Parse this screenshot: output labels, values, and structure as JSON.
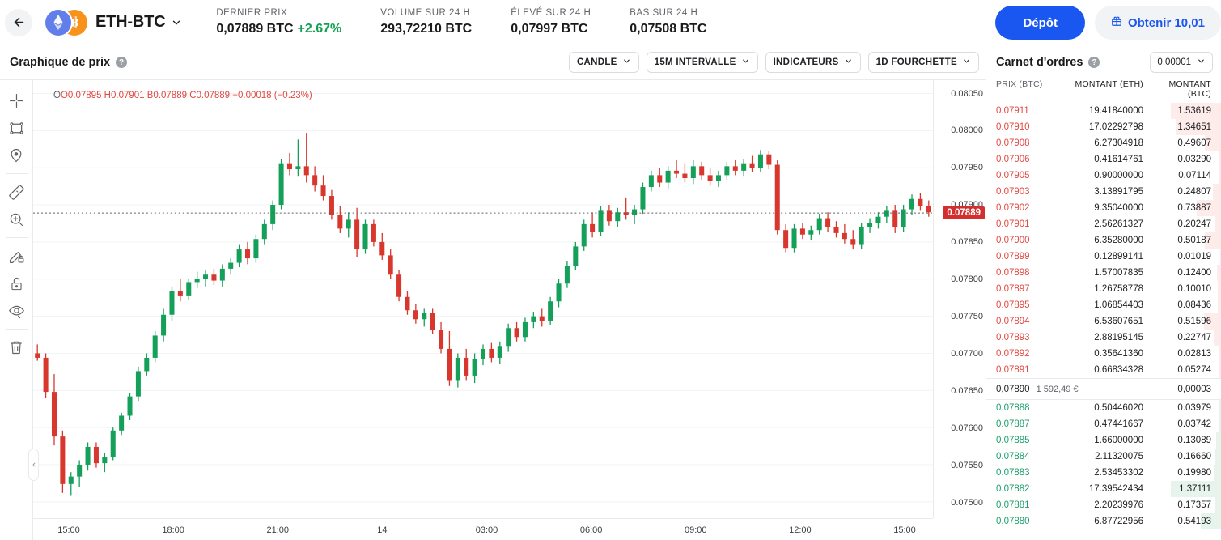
{
  "header": {
    "back_icon": "arrow-left-icon",
    "pair": {
      "name": "ETH-BTC",
      "base_icon": "ethereum-icon",
      "quote_icon": "bitcoin-icon",
      "caret_icon": "chevron-down-icon"
    },
    "stats": [
      {
        "label": "DERNIER PRIX",
        "value": "0,07889 BTC",
        "change": "+2.67%"
      },
      {
        "label": "VOLUME SUR 24 H",
        "value": "293,72210 BTC",
        "change": ""
      },
      {
        "label": "ÉLEVÉ SUR 24 H",
        "value": "0,07997 BTC",
        "change": ""
      },
      {
        "label": "BAS SUR 24 H",
        "value": "0,07508 BTC",
        "change": ""
      }
    ],
    "deposit_button": "Dépôt",
    "obtenir_button": "Obtenir 10,01",
    "obtenir_icon": "gift-icon"
  },
  "chart": {
    "title": "Graphique de prix",
    "help_icon": "help-circle-icon",
    "controls": [
      {
        "label": "CANDLE",
        "icon": "chevron-down-icon"
      },
      {
        "label": "15M INTERVALLE",
        "icon": "chevron-down-icon"
      },
      {
        "label": "INDICATEURS",
        "icon": "chevron-down-icon"
      },
      {
        "label": "1D FOURCHETTE",
        "icon": "chevron-down-icon"
      }
    ],
    "ohlc": {
      "o": "O0.07895",
      "h": "H0.07901",
      "b": "B0.07889",
      "c": "C0.07889",
      "chg": "−0.00018 (−0.23%)"
    },
    "tools": [
      "crosshair-icon",
      "shape-rectangle-icon",
      "location-pin-icon",
      "ruler-icon",
      "zoom-in-icon",
      "pencil-lock-icon",
      "lock-icon",
      "eye-icon",
      "trash-icon"
    ],
    "collapse_icon": "chevron-left-icon",
    "current_price_marker": "0.07889",
    "colors": {
      "up": "#15a05a",
      "down": "#d8372e",
      "marker": "#d32f2f"
    }
  },
  "chart_data": {
    "type": "line",
    "title": "Graphique de prix",
    "xlabel": "",
    "ylabel": "",
    "ylim": [
      0.07478,
      0.08068
    ],
    "y_ticks": [
      "0.08050",
      "0.08000",
      "0.07950",
      "0.07900",
      "0.07850",
      "0.07800",
      "0.07750",
      "0.07700",
      "0.07650",
      "0.07600",
      "0.07550",
      "0.07500"
    ],
    "x_ticks": [
      "15:00",
      "18:00",
      "21:00",
      "14",
      "03:00",
      "06:00",
      "09:00",
      "12:00",
      "15:00"
    ],
    "grid": true,
    "legend": "none",
    "current_price": 0.07889,
    "ohlc": [
      {
        "o": 0.077,
        "h": 0.07712,
        "l": 0.0769,
        "c": 0.07694
      },
      {
        "o": 0.07694,
        "h": 0.077,
        "l": 0.0764,
        "c": 0.07648
      },
      {
        "o": 0.07648,
        "h": 0.07672,
        "l": 0.07576,
        "c": 0.07588
      },
      {
        "o": 0.07588,
        "h": 0.07596,
        "l": 0.07512,
        "c": 0.07524
      },
      {
        "o": 0.07524,
        "h": 0.0754,
        "l": 0.07508,
        "c": 0.07534
      },
      {
        "o": 0.07534,
        "h": 0.07556,
        "l": 0.0752,
        "c": 0.0755
      },
      {
        "o": 0.0755,
        "h": 0.0758,
        "l": 0.07542,
        "c": 0.07574
      },
      {
        "o": 0.07574,
        "h": 0.0758,
        "l": 0.07546,
        "c": 0.07552
      },
      {
        "o": 0.07552,
        "h": 0.07566,
        "l": 0.0754,
        "c": 0.0756
      },
      {
        "o": 0.0756,
        "h": 0.076,
        "l": 0.07556,
        "c": 0.07596
      },
      {
        "o": 0.07596,
        "h": 0.0762,
        "l": 0.0759,
        "c": 0.07616
      },
      {
        "o": 0.07616,
        "h": 0.07646,
        "l": 0.0761,
        "c": 0.07642
      },
      {
        "o": 0.07642,
        "h": 0.07682,
        "l": 0.07636,
        "c": 0.07676
      },
      {
        "o": 0.07676,
        "h": 0.077,
        "l": 0.0767,
        "c": 0.07694
      },
      {
        "o": 0.07694,
        "h": 0.0773,
        "l": 0.07688,
        "c": 0.07724
      },
      {
        "o": 0.07724,
        "h": 0.0776,
        "l": 0.07716,
        "c": 0.07752
      },
      {
        "o": 0.07752,
        "h": 0.0779,
        "l": 0.07744,
        "c": 0.07784
      },
      {
        "o": 0.07784,
        "h": 0.078,
        "l": 0.0777,
        "c": 0.07778
      },
      {
        "o": 0.07778,
        "h": 0.078,
        "l": 0.07772,
        "c": 0.07796
      },
      {
        "o": 0.07796,
        "h": 0.0781,
        "l": 0.07788,
        "c": 0.078
      },
      {
        "o": 0.078,
        "h": 0.07812,
        "l": 0.0779,
        "c": 0.07806
      },
      {
        "o": 0.07806,
        "h": 0.07814,
        "l": 0.07792,
        "c": 0.07798
      },
      {
        "o": 0.07798,
        "h": 0.0782,
        "l": 0.0779,
        "c": 0.07814
      },
      {
        "o": 0.07814,
        "h": 0.07828,
        "l": 0.07806,
        "c": 0.07822
      },
      {
        "o": 0.07822,
        "h": 0.07846,
        "l": 0.07816,
        "c": 0.0784
      },
      {
        "o": 0.0784,
        "h": 0.0785,
        "l": 0.0782,
        "c": 0.07828
      },
      {
        "o": 0.07828,
        "h": 0.0786,
        "l": 0.07822,
        "c": 0.07854
      },
      {
        "o": 0.07854,
        "h": 0.0788,
        "l": 0.07846,
        "c": 0.07874
      },
      {
        "o": 0.07874,
        "h": 0.07906,
        "l": 0.07866,
        "c": 0.079
      },
      {
        "o": 0.079,
        "h": 0.07962,
        "l": 0.07894,
        "c": 0.07956
      },
      {
        "o": 0.07956,
        "h": 0.0797,
        "l": 0.0794,
        "c": 0.07948
      },
      {
        "o": 0.07948,
        "h": 0.07988,
        "l": 0.07938,
        "c": 0.07952
      },
      {
        "o": 0.07952,
        "h": 0.07997,
        "l": 0.0793,
        "c": 0.0794
      },
      {
        "o": 0.0794,
        "h": 0.07952,
        "l": 0.07918,
        "c": 0.07926
      },
      {
        "o": 0.07926,
        "h": 0.0794,
        "l": 0.07906,
        "c": 0.07912
      },
      {
        "o": 0.07912,
        "h": 0.0792,
        "l": 0.0788,
        "c": 0.07886
      },
      {
        "o": 0.07886,
        "h": 0.07898,
        "l": 0.07862,
        "c": 0.07868
      },
      {
        "o": 0.07868,
        "h": 0.0789,
        "l": 0.07856,
        "c": 0.0788
      },
      {
        "o": 0.0788,
        "h": 0.07896,
        "l": 0.0783,
        "c": 0.0784
      },
      {
        "o": 0.0784,
        "h": 0.0788,
        "l": 0.07834,
        "c": 0.07874
      },
      {
        "o": 0.07874,
        "h": 0.0788,
        "l": 0.07844,
        "c": 0.0785
      },
      {
        "o": 0.0785,
        "h": 0.07862,
        "l": 0.07826,
        "c": 0.07832
      },
      {
        "o": 0.07832,
        "h": 0.0784,
        "l": 0.078,
        "c": 0.07806
      },
      {
        "o": 0.07806,
        "h": 0.07812,
        "l": 0.0777,
        "c": 0.07776
      },
      {
        "o": 0.07776,
        "h": 0.07784,
        "l": 0.07752,
        "c": 0.07758
      },
      {
        "o": 0.07758,
        "h": 0.07766,
        "l": 0.0774,
        "c": 0.07746
      },
      {
        "o": 0.07746,
        "h": 0.0776,
        "l": 0.07736,
        "c": 0.07754
      },
      {
        "o": 0.07754,
        "h": 0.0776,
        "l": 0.07726,
        "c": 0.07732
      },
      {
        "o": 0.07732,
        "h": 0.07742,
        "l": 0.077,
        "c": 0.07706
      },
      {
        "o": 0.07706,
        "h": 0.0773,
        "l": 0.07656,
        "c": 0.07664
      },
      {
        "o": 0.07664,
        "h": 0.077,
        "l": 0.07654,
        "c": 0.07694
      },
      {
        "o": 0.07694,
        "h": 0.07706,
        "l": 0.07664,
        "c": 0.0767
      },
      {
        "o": 0.0767,
        "h": 0.077,
        "l": 0.0766,
        "c": 0.07692
      },
      {
        "o": 0.07692,
        "h": 0.07712,
        "l": 0.07684,
        "c": 0.07706
      },
      {
        "o": 0.07706,
        "h": 0.07714,
        "l": 0.07688,
        "c": 0.07694
      },
      {
        "o": 0.07694,
        "h": 0.07716,
        "l": 0.07686,
        "c": 0.0771
      },
      {
        "o": 0.0771,
        "h": 0.0774,
        "l": 0.07702,
        "c": 0.07734
      },
      {
        "o": 0.07734,
        "h": 0.07742,
        "l": 0.07716,
        "c": 0.07722
      },
      {
        "o": 0.07722,
        "h": 0.07748,
        "l": 0.07716,
        "c": 0.07742
      },
      {
        "o": 0.07742,
        "h": 0.07756,
        "l": 0.07734,
        "c": 0.0775
      },
      {
        "o": 0.0775,
        "h": 0.0776,
        "l": 0.07736,
        "c": 0.07744
      },
      {
        "o": 0.07744,
        "h": 0.07776,
        "l": 0.07738,
        "c": 0.0777
      },
      {
        "o": 0.0777,
        "h": 0.078,
        "l": 0.07762,
        "c": 0.07794
      },
      {
        "o": 0.07794,
        "h": 0.07824,
        "l": 0.07788,
        "c": 0.07818
      },
      {
        "o": 0.07818,
        "h": 0.0785,
        "l": 0.07812,
        "c": 0.07844
      },
      {
        "o": 0.07844,
        "h": 0.0788,
        "l": 0.07838,
        "c": 0.07874
      },
      {
        "o": 0.07874,
        "h": 0.0789,
        "l": 0.07856,
        "c": 0.07864
      },
      {
        "o": 0.07864,
        "h": 0.07898,
        "l": 0.07858,
        "c": 0.07892
      },
      {
        "o": 0.07892,
        "h": 0.079,
        "l": 0.07872,
        "c": 0.07878
      },
      {
        "o": 0.07878,
        "h": 0.07896,
        "l": 0.0787,
        "c": 0.0789
      },
      {
        "o": 0.0789,
        "h": 0.0791,
        "l": 0.0788,
        "c": 0.07886
      },
      {
        "o": 0.07886,
        "h": 0.079,
        "l": 0.07874,
        "c": 0.07894
      },
      {
        "o": 0.07894,
        "h": 0.0793,
        "l": 0.07888,
        "c": 0.07924
      },
      {
        "o": 0.07924,
        "h": 0.07946,
        "l": 0.07918,
        "c": 0.0794
      },
      {
        "o": 0.0794,
        "h": 0.0795,
        "l": 0.07924,
        "c": 0.0793
      },
      {
        "o": 0.0793,
        "h": 0.07952,
        "l": 0.07922,
        "c": 0.07946
      },
      {
        "o": 0.07946,
        "h": 0.0796,
        "l": 0.07936,
        "c": 0.07942
      },
      {
        "o": 0.07942,
        "h": 0.07956,
        "l": 0.0793,
        "c": 0.07936
      },
      {
        "o": 0.07936,
        "h": 0.0796,
        "l": 0.07928,
        "c": 0.07952
      },
      {
        "o": 0.07952,
        "h": 0.07958,
        "l": 0.07934,
        "c": 0.0794
      },
      {
        "o": 0.0794,
        "h": 0.0795,
        "l": 0.07926,
        "c": 0.07932
      },
      {
        "o": 0.07932,
        "h": 0.07946,
        "l": 0.07924,
        "c": 0.0794
      },
      {
        "o": 0.0794,
        "h": 0.07958,
        "l": 0.07934,
        "c": 0.07952
      },
      {
        "o": 0.07952,
        "h": 0.0796,
        "l": 0.0794,
        "c": 0.07946
      },
      {
        "o": 0.07946,
        "h": 0.07962,
        "l": 0.07938,
        "c": 0.07956
      },
      {
        "o": 0.07956,
        "h": 0.07966,
        "l": 0.07944,
        "c": 0.0795
      },
      {
        "o": 0.0795,
        "h": 0.07974,
        "l": 0.07944,
        "c": 0.07968
      },
      {
        "o": 0.07968,
        "h": 0.07972,
        "l": 0.07948,
        "c": 0.07954
      },
      {
        "o": 0.07954,
        "h": 0.0796,
        "l": 0.0786,
        "c": 0.07866
      },
      {
        "o": 0.07866,
        "h": 0.07874,
        "l": 0.07836,
        "c": 0.07842
      },
      {
        "o": 0.07842,
        "h": 0.07874,
        "l": 0.07836,
        "c": 0.07868
      },
      {
        "o": 0.07868,
        "h": 0.07876,
        "l": 0.07854,
        "c": 0.0786
      },
      {
        "o": 0.0786,
        "h": 0.07872,
        "l": 0.07852,
        "c": 0.07866
      },
      {
        "o": 0.07866,
        "h": 0.07888,
        "l": 0.0786,
        "c": 0.07882
      },
      {
        "o": 0.07882,
        "h": 0.0789,
        "l": 0.07864,
        "c": 0.0787
      },
      {
        "o": 0.0787,
        "h": 0.07878,
        "l": 0.07856,
        "c": 0.07862
      },
      {
        "o": 0.07862,
        "h": 0.07874,
        "l": 0.07848,
        "c": 0.07854
      },
      {
        "o": 0.07854,
        "h": 0.07866,
        "l": 0.0784,
        "c": 0.07846
      },
      {
        "o": 0.07846,
        "h": 0.07876,
        "l": 0.0784,
        "c": 0.0787
      },
      {
        "o": 0.0787,
        "h": 0.07882,
        "l": 0.07862,
        "c": 0.07876
      },
      {
        "o": 0.07876,
        "h": 0.0789,
        "l": 0.07868,
        "c": 0.07884
      },
      {
        "o": 0.07884,
        "h": 0.07898,
        "l": 0.07876,
        "c": 0.07892
      },
      {
        "o": 0.07892,
        "h": 0.079,
        "l": 0.07862,
        "c": 0.0787
      },
      {
        "o": 0.0787,
        "h": 0.079,
        "l": 0.07864,
        "c": 0.07894
      },
      {
        "o": 0.07894,
        "h": 0.07914,
        "l": 0.07886,
        "c": 0.07908
      },
      {
        "o": 0.07908,
        "h": 0.07916,
        "l": 0.07892,
        "c": 0.07898
      },
      {
        "o": 0.07898,
        "h": 0.07906,
        "l": 0.07884,
        "c": 0.0789
      }
    ]
  },
  "orderbook": {
    "title": "Carnet d'ordres",
    "help_icon": "help-circle-icon",
    "grouping": "0.00001",
    "grouping_icon": "chevron-down-icon",
    "columns": [
      "PRIX (BTC)",
      "MONTANT (ETH)",
      "MONTANT (BTC)"
    ],
    "asks": [
      {
        "price": "0.07911",
        "amount": "19.41840000",
        "total": "1.53619",
        "depth": 100
      },
      {
        "price": "0.07910",
        "amount": "17.02292798",
        "total": "1.34651",
        "depth": 88
      },
      {
        "price": "0.07908",
        "amount": "6.27304918",
        "total": "0.49607",
        "depth": 32
      },
      {
        "price": "0.07906",
        "amount": "0.41614761",
        "total": "0.03290",
        "depth": 3
      },
      {
        "price": "0.07905",
        "amount": "0.90000000",
        "total": "0.07114",
        "depth": 5
      },
      {
        "price": "0.07903",
        "amount": "3.13891795",
        "total": "0.24807",
        "depth": 16
      },
      {
        "price": "0.07902",
        "amount": "9.35040000",
        "total": "0.73887",
        "depth": 48
      },
      {
        "price": "0.07901",
        "amount": "2.56261327",
        "total": "0.20247",
        "depth": 13
      },
      {
        "price": "0.07900",
        "amount": "6.35280000",
        "total": "0.50187",
        "depth": 33
      },
      {
        "price": "0.07899",
        "amount": "0.12899141",
        "total": "0.01019",
        "depth": 2
      },
      {
        "price": "0.07898",
        "amount": "1.57007835",
        "total": "0.12400",
        "depth": 8
      },
      {
        "price": "0.07897",
        "amount": "1.26758778",
        "total": "0.10010",
        "depth": 7
      },
      {
        "price": "0.07895",
        "amount": "1.06854403",
        "total": "0.08436",
        "depth": 6
      },
      {
        "price": "0.07894",
        "amount": "6.53607651",
        "total": "0.51596",
        "depth": 34
      },
      {
        "price": "0.07893",
        "amount": "2.88195145",
        "total": "0.22747",
        "depth": 15
      },
      {
        "price": "0.07892",
        "amount": "0.35641360",
        "total": "0.02813",
        "depth": 3
      },
      {
        "price": "0.07891",
        "amount": "0.66834328",
        "total": "0.05274",
        "depth": 4
      }
    ],
    "spread": {
      "price": "0,07890",
      "fiat": "1 592,49 €",
      "total": "0,00003"
    },
    "bids": [
      {
        "price": "0.07888",
        "amount": "0.50446020",
        "total": "0.03979",
        "depth": 3
      },
      {
        "price": "0.07887",
        "amount": "0.47441667",
        "total": "0.03742",
        "depth": 3
      },
      {
        "price": "0.07885",
        "amount": "1.66000000",
        "total": "0.13089",
        "depth": 9
      },
      {
        "price": "0.07884",
        "amount": "2.11320075",
        "total": "0.16660",
        "depth": 12
      },
      {
        "price": "0.07883",
        "amount": "2.53453302",
        "total": "0.19980",
        "depth": 14
      },
      {
        "price": "0.07882",
        "amount": "17.39542434",
        "total": "1.37111",
        "depth": 100
      },
      {
        "price": "0.07881",
        "amount": "2.20239976",
        "total": "0.17357",
        "depth": 13
      },
      {
        "price": "0.07880",
        "amount": "6.87722956",
        "total": "0.54193",
        "depth": 40
      }
    ]
  }
}
